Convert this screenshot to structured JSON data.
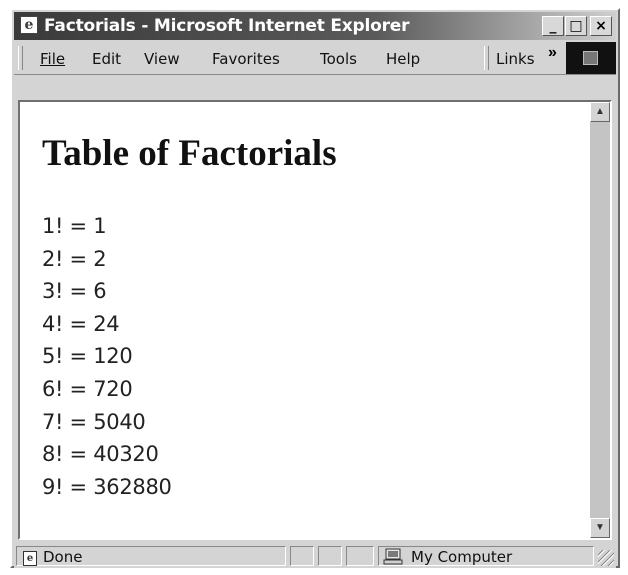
{
  "window": {
    "title": "Factorials - Microsoft Internet Explorer",
    "controls": {
      "minimize": "_",
      "maximize": "□",
      "close": "×"
    }
  },
  "menubar": {
    "items": [
      {
        "label": "File",
        "icon": "none"
      },
      {
        "label": "Edit",
        "icon": "none"
      },
      {
        "label": "View",
        "icon": "none"
      },
      {
        "label": "Favorites",
        "icon": "none"
      },
      {
        "label": "Tools",
        "icon": "none"
      },
      {
        "label": "Help",
        "icon": "none"
      }
    ],
    "links_label": "Links",
    "chevron": "»"
  },
  "page": {
    "heading": "Table of Factorials",
    "lines": [
      "1! = 1",
      "2! = 2",
      "3! = 6",
      "4! = 24",
      "5! = 120",
      "6! = 720",
      "7! = 5040",
      "8! = 40320",
      "9! = 362880"
    ]
  },
  "statusbar": {
    "status": "Done",
    "zone": "My Computer"
  },
  "colors": {
    "titlebar_start": "#3a3a3a",
    "titlebar_end": "#cfcfcf",
    "chrome": "#d4d4d4"
  }
}
